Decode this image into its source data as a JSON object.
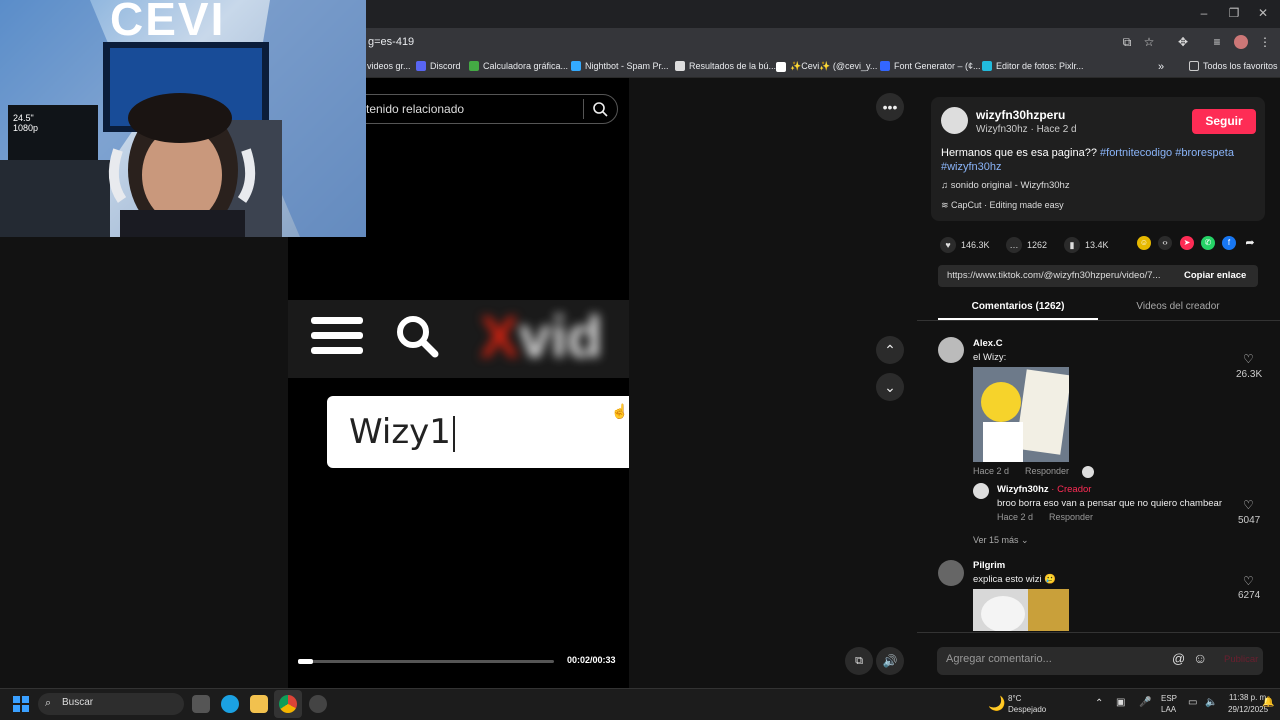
{
  "browser": {
    "address_fragment": "g=es-419",
    "bookmarks": [
      {
        "label": "videos gr...",
        "color": "#e44"
      },
      {
        "label": "Discord",
        "color": "#5865f2"
      },
      {
        "label": "Calculadora gráfica...",
        "color": "#4a4"
      },
      {
        "label": "Nightbot - Spam Pr...",
        "color": "#3af"
      },
      {
        "label": "Resultados de la bú...",
        "color": "#ddd"
      },
      {
        "label": "✨Cevi✨ (@cevi_y...",
        "color": "#222"
      },
      {
        "label": "Font Generator – (¢...",
        "color": "#36f"
      },
      {
        "label": "Editor de fotos: Pixlr...",
        "color": "#2bd"
      }
    ],
    "all_favorites": "Todos los favoritos"
  },
  "video": {
    "search_placeholder": "tenido relacionado",
    "typed_text": "Wizy1",
    "time": "00:02/00:33",
    "progress": 0.06
  },
  "webcam": {
    "banner_text": "CEVI",
    "monitor_label": "24.5\" 1080p"
  },
  "post": {
    "username": "wizyfn30hzperu",
    "subline": "Wizyfn30hz · Hace 2 d",
    "follow_label": "Seguir",
    "description": "Hermanos que es esa pagina??",
    "hashtags": [
      "#fortnitecodigo",
      "#brorespeta",
      "#wizyfn30hz"
    ],
    "music": "sonido original - Wizyfn30hz",
    "capcut": "CapCut · Editing made easy",
    "likes": "146.3K",
    "comments": "1262",
    "saves": "13.4K",
    "link": "https://www.tiktok.com/@wizyfn30hzperu/video/7...",
    "copy_label": "Copiar enlace"
  },
  "tabs": {
    "comments": "Comentarios (1262)",
    "creator_videos": "Videos del creador"
  },
  "comments": [
    {
      "name": "Alex.C",
      "text": "el Wizy:",
      "meta": "Hace 2 d",
      "reply": "Responder",
      "likes": "26.3K"
    },
    {
      "name": "Wizyfn30hz",
      "creator": "· Creador",
      "text": "broo borra eso van a pensar que no quiero chambear",
      "meta": "Hace 2 d",
      "reply": "Responder",
      "likes": "5047"
    },
    {
      "name": "Pilgrim",
      "text": "explica esto wizi 🥲",
      "likes": "6274"
    }
  ],
  "view_more": "Ver 15 más",
  "comment_placeholder": "Agregar comentario...",
  "publish_label": "Publicar",
  "taskbar": {
    "search_label": "Buscar",
    "weather_temp": "8°C",
    "weather_desc": "Despejado",
    "lang": "ESP",
    "lang2": "LAA",
    "time": "11:38 p. m.",
    "date": "29/12/2025"
  }
}
